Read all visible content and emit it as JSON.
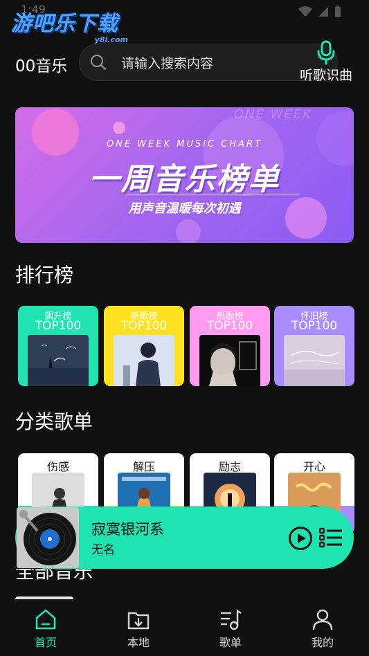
{
  "status_bar": {
    "time": "1:49"
  },
  "watermark": {
    "main": "游吧乐下载",
    "sub": "y8l.com"
  },
  "header": {
    "app_name": "00音乐",
    "search_placeholder": "请输入搜索内容",
    "recognize_label": "听歌识曲"
  },
  "banner": {
    "english": "ONE WEEK MUSIC CHART",
    "title": "一周音乐榜单",
    "subtitle": "用声音温暖每次初遇",
    "ghost_text": "ONE WEEK"
  },
  "rankings": {
    "title": "排行榜",
    "items": [
      {
        "label": "飙升榜",
        "sub": "TOP100",
        "color": "#1fe3b1"
      },
      {
        "label": "新歌榜",
        "sub": "TOP100",
        "color": "#ffe11f"
      },
      {
        "label": "热歌榜",
        "sub": "TOP100",
        "color": "#ff9bf0"
      },
      {
        "label": "怀旧榜",
        "sub": "TOP100",
        "color": "#a98cff"
      }
    ]
  },
  "categories": {
    "title": "分类歌单",
    "items": [
      {
        "label": "伤感",
        "color": "#1fe3b1"
      },
      {
        "label": "解压",
        "color": "#ffe11f"
      },
      {
        "label": "励志",
        "color": "#ff9bf0"
      },
      {
        "label": "开心",
        "color": "#a98cff"
      }
    ]
  },
  "all_music": {
    "title": "全部音乐"
  },
  "player": {
    "title": "寂寞银河系",
    "artist": "无名",
    "accent": "#1fe3b1"
  },
  "nav": {
    "items": [
      {
        "label": "首页",
        "icon": "home-icon",
        "active": true
      },
      {
        "label": "本地",
        "icon": "download-folder-icon",
        "active": false
      },
      {
        "label": "歌单",
        "icon": "playlist-icon",
        "active": false
      },
      {
        "label": "我的",
        "icon": "user-icon",
        "active": false
      }
    ]
  }
}
